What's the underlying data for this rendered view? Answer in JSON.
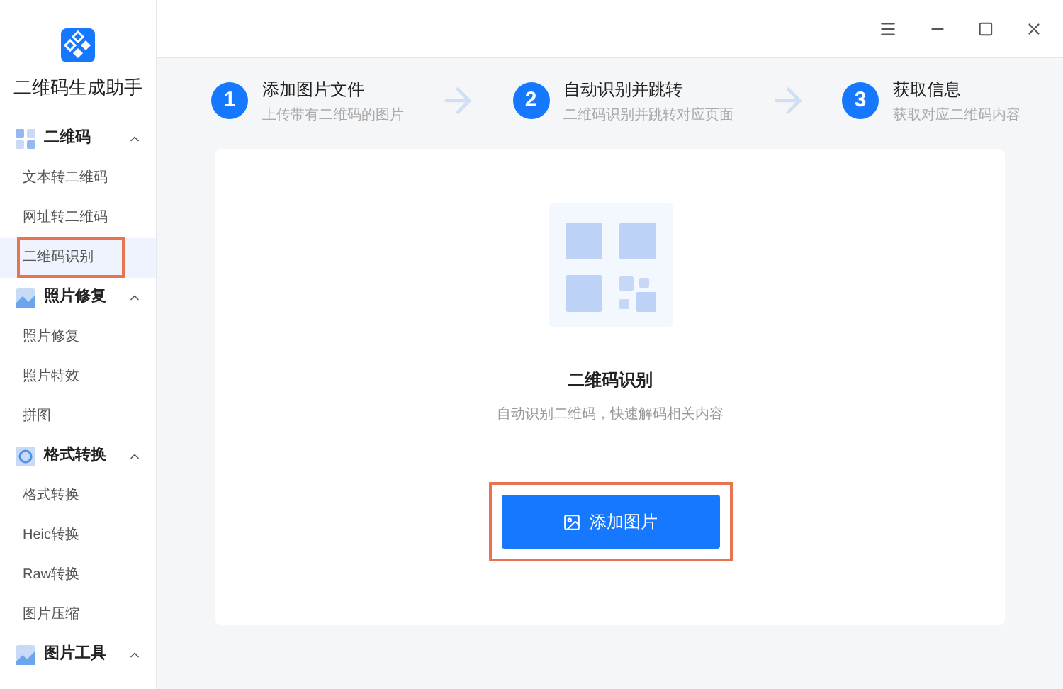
{
  "app": {
    "title": "二维码生成助手"
  },
  "sidebar": {
    "groups": [
      {
        "label": "二维码",
        "expanded": true,
        "items": [
          {
            "label": "文本转二维码",
            "selected": false
          },
          {
            "label": "网址转二维码",
            "selected": false
          },
          {
            "label": "二维码识别",
            "selected": true
          }
        ]
      },
      {
        "label": "照片修复",
        "expanded": true,
        "items": [
          {
            "label": "照片修复",
            "selected": false
          },
          {
            "label": "照片特效",
            "selected": false
          },
          {
            "label": "拼图",
            "selected": false
          }
        ]
      },
      {
        "label": "格式转换",
        "expanded": true,
        "items": [
          {
            "label": "格式转换",
            "selected": false
          },
          {
            "label": "Heic转换",
            "selected": false
          },
          {
            "label": "Raw转换",
            "selected": false
          },
          {
            "label": "图片压缩",
            "selected": false
          }
        ]
      },
      {
        "label": "图片工具",
        "expanded": true
      }
    ]
  },
  "steps": [
    {
      "number": "1",
      "title": "添加图片文件",
      "subtitle": "上传带有二维码的图片"
    },
    {
      "number": "2",
      "title": "自动识别并跳转",
      "subtitle": "二维码识别并跳转对应页面"
    },
    {
      "number": "3",
      "title": "获取信息",
      "subtitle": "获取对应二维码内容"
    }
  ],
  "panel": {
    "title": "二维码识别",
    "description": "自动识别二维码，快速解码相关内容",
    "button": {
      "label": "添加图片",
      "highlighted": true
    }
  }
}
